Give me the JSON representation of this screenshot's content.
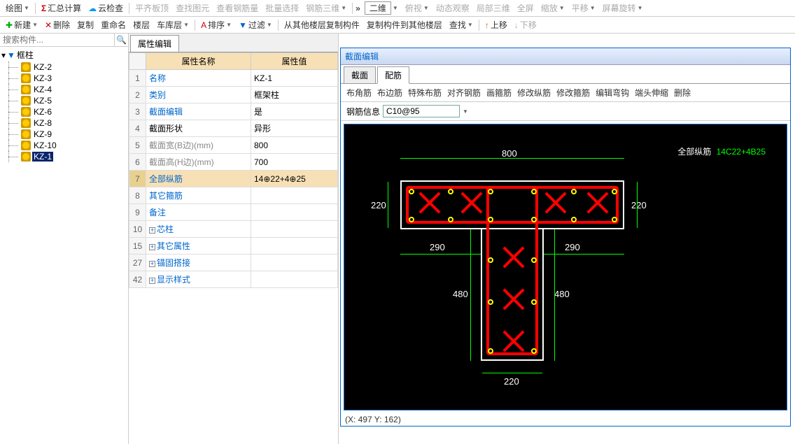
{
  "toolbar1": {
    "draw": "绘图",
    "summary": "汇总计算",
    "cloud": "云检查",
    "flat_top": "平齐板顶",
    "find_elem": "查找图元",
    "view_rebar": "查看钢筋量",
    "batch_sel": "批量选择",
    "rebar_3d": "钢筋三维",
    "view2d": "二维",
    "top_view": "俯视",
    "dyn_view": "动态观察",
    "local_3d": "局部三维",
    "fullscreen": "全屏",
    "zoom": "缩放",
    "pan": "平移",
    "screen_rot": "屏幕旋转"
  },
  "toolbar2": {
    "new": "新建",
    "delete": "删除",
    "copy": "复制",
    "rename": "重命名",
    "floor": "楼层",
    "garage": "车库层",
    "sort": "排序",
    "filter": "过滤",
    "copy_from": "从其他楼层复制构件",
    "copy_to": "复制构件到其他楼层",
    "find": "查找",
    "move_up": "上移",
    "move_down": "下移"
  },
  "search": {
    "placeholder": "搜索构件..."
  },
  "tree": {
    "root": "框柱",
    "items": [
      "KZ-2",
      "KZ-3",
      "KZ-4",
      "KZ-5",
      "KZ-6",
      "KZ-8",
      "KZ-9",
      "KZ-10",
      "KZ-1"
    ]
  },
  "prop_tab": "属性编辑",
  "prop_headers": {
    "name": "属性名称",
    "value": "属性值"
  },
  "props": [
    {
      "n": "1",
      "name": "名称",
      "val": "KZ-1",
      "blue": true
    },
    {
      "n": "2",
      "name": "类别",
      "val": "框架柱",
      "blue": true
    },
    {
      "n": "3",
      "name": "截面编辑",
      "val": "是",
      "blue": true
    },
    {
      "n": "4",
      "name": "截面形状",
      "val": "异形",
      "black": true
    },
    {
      "n": "5",
      "name": "截面宽(B边)(mm)",
      "val": "800",
      "gray": true
    },
    {
      "n": "6",
      "name": "截面高(H边)(mm)",
      "val": "700",
      "gray": true
    },
    {
      "n": "7",
      "name": "全部纵筋",
      "val": "14⊕22+4⊕25",
      "blue": true,
      "sel": true
    },
    {
      "n": "8",
      "name": "其它箍筋",
      "val": "",
      "blue": true
    },
    {
      "n": "9",
      "name": "备注",
      "val": "",
      "blue": true
    },
    {
      "n": "10",
      "name": "芯柱",
      "val": "",
      "exp": true
    },
    {
      "n": "15",
      "name": "其它属性",
      "val": "",
      "exp": true
    },
    {
      "n": "27",
      "name": "锚固搭接",
      "val": "",
      "exp": true
    },
    {
      "n": "42",
      "name": "显示样式",
      "val": "",
      "exp": true
    }
  ],
  "section": {
    "title": "截面编辑",
    "tabs": [
      "截面",
      "配筋"
    ],
    "rebar_tools": [
      "布角筋",
      "布边筋",
      "特殊布筋",
      "对齐钢筋",
      "画箍筋",
      "修改纵筋",
      "修改箍筋",
      "编辑弯钩",
      "端头伸缩",
      "删除"
    ],
    "info_label": "钢筋信息",
    "info_value": "C10@95",
    "label_all": "全部纵筋",
    "label_val": "14C22+4B25",
    "dims": {
      "top": "800",
      "left1": "220",
      "right1": "220",
      "left2": "290",
      "right2": "290",
      "left3": "480",
      "right3": "480",
      "bottom": "220"
    },
    "status": "(X: 497 Y: 162)"
  }
}
